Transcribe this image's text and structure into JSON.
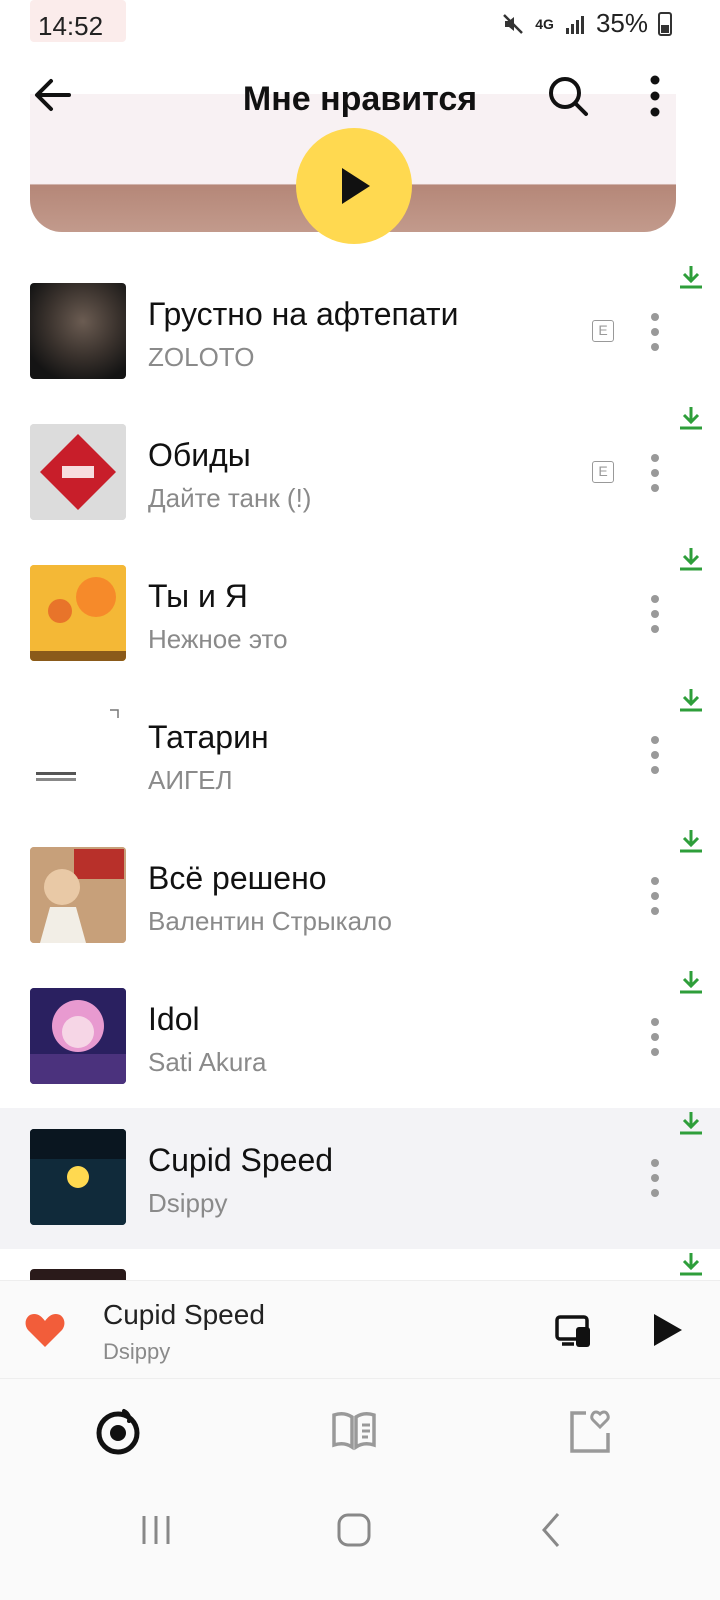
{
  "status_bar": {
    "time": "14:52",
    "battery": "35%",
    "network": "4G"
  },
  "header": {
    "title": "Мне нравится"
  },
  "tracks": [
    {
      "title": "Грустно на афтепати",
      "artist": "ZOLOTO",
      "explicit": true,
      "explicit_label": "E"
    },
    {
      "title": "Обиды",
      "artist": "Дайте танк (!)",
      "explicit": true,
      "explicit_label": "E"
    },
    {
      "title": "Ты и Я",
      "artist": "Нежное это",
      "explicit": false
    },
    {
      "title": "Татарин",
      "artist": "АИГЕЛ",
      "explicit": false
    },
    {
      "title": "Всё решено",
      "artist": "Валентин Стрыкало",
      "explicit": false
    },
    {
      "title": "Idol",
      "artist": "Sati Akura",
      "explicit": false
    },
    {
      "title": "Cupid Speed",
      "artist": "Dsippy",
      "explicit": false,
      "playing": true
    }
  ],
  "mini_player": {
    "title": "Cupid Speed",
    "artist": "Dsippy"
  },
  "colors": {
    "accent": "#ffd950",
    "download": "#2e9e3a",
    "heart": "#f25d3a"
  },
  "icons": {
    "nav": [
      "radio-icon",
      "library-icon",
      "favorites-icon"
    ],
    "system": [
      "recents-icon",
      "home-icon",
      "back-icon"
    ]
  }
}
